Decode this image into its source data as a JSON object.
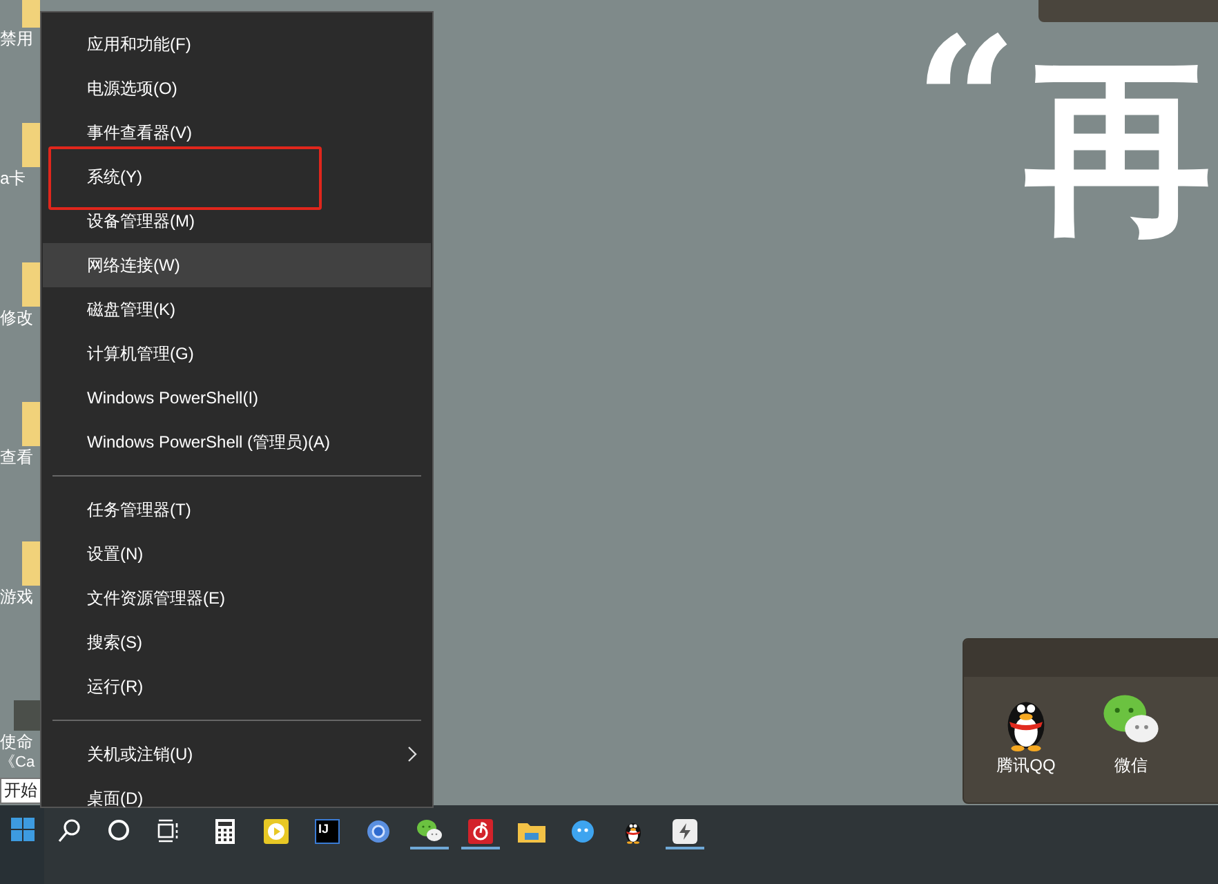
{
  "desktop_icons": [
    {
      "kind": "folder",
      "label": "禁用"
    },
    {
      "kind": "folder",
      "label": "a卡"
    },
    {
      "kind": "folder",
      "label": "修改"
    },
    {
      "kind": "folder",
      "label": "查看"
    },
    {
      "kind": "folder",
      "label": "游戏"
    },
    {
      "kind": "game",
      "label": "使命",
      "label_2": "《Ca"
    }
  ],
  "start_tooltip": "开始",
  "wallpaper": {
    "quote": "“",
    "glyph": "再"
  },
  "context_menu": {
    "groups": [
      {
        "items": [
          {
            "label": "应用和功能(F)",
            "selected": false,
            "annotated": false,
            "submenu": false
          },
          {
            "label": "电源选项(O)",
            "selected": false,
            "annotated": false,
            "submenu": false
          },
          {
            "label": "事件查看器(V)",
            "selected": false,
            "annotated": false,
            "submenu": false
          },
          {
            "label": "系统(Y)",
            "selected": false,
            "annotated": true,
            "submenu": false
          },
          {
            "label": "设备管理器(M)",
            "selected": false,
            "annotated": false,
            "submenu": false
          },
          {
            "label": "网络连接(W)",
            "selected": true,
            "annotated": false,
            "submenu": false
          },
          {
            "label": "磁盘管理(K)",
            "selected": false,
            "annotated": false,
            "submenu": false
          },
          {
            "label": "计算机管理(G)",
            "selected": false,
            "annotated": false,
            "submenu": false
          },
          {
            "label": "Windows PowerShell(I)",
            "selected": false,
            "annotated": false,
            "submenu": false
          },
          {
            "label": "Windows PowerShell (管理员)(A)",
            "selected": false,
            "annotated": false,
            "submenu": false
          }
        ]
      },
      {
        "items": [
          {
            "label": "任务管理器(T)",
            "selected": false,
            "annotated": false,
            "submenu": false
          },
          {
            "label": "设置(N)",
            "selected": false,
            "annotated": false,
            "submenu": false
          },
          {
            "label": "文件资源管理器(E)",
            "selected": false,
            "annotated": false,
            "submenu": false
          },
          {
            "label": "搜索(S)",
            "selected": false,
            "annotated": false,
            "submenu": false
          },
          {
            "label": "运行(R)",
            "selected": false,
            "annotated": false,
            "submenu": false
          }
        ]
      },
      {
        "items": [
          {
            "label": "关机或注销(U)",
            "selected": false,
            "annotated": false,
            "submenu": true
          },
          {
            "label": "桌面(D)",
            "selected": false,
            "annotated": false,
            "submenu": false
          }
        ]
      }
    ]
  },
  "tray_popup": {
    "apps": [
      {
        "kind": "qq",
        "label": "腾讯QQ"
      },
      {
        "kind": "wechat",
        "label": "微信"
      }
    ]
  },
  "taskbar": {
    "pinned": [
      {
        "kind": "calculator",
        "running": false
      },
      {
        "kind": "player",
        "running": false
      },
      {
        "kind": "ide",
        "label": "IJ",
        "running": false
      },
      {
        "kind": "browser",
        "running": false
      },
      {
        "kind": "wechat",
        "running": true
      },
      {
        "kind": "music",
        "running": true
      },
      {
        "kind": "explorer",
        "running": false
      },
      {
        "kind": "bird",
        "running": false
      },
      {
        "kind": "qq",
        "running": false
      },
      {
        "kind": "bolt",
        "running": true
      }
    ]
  }
}
